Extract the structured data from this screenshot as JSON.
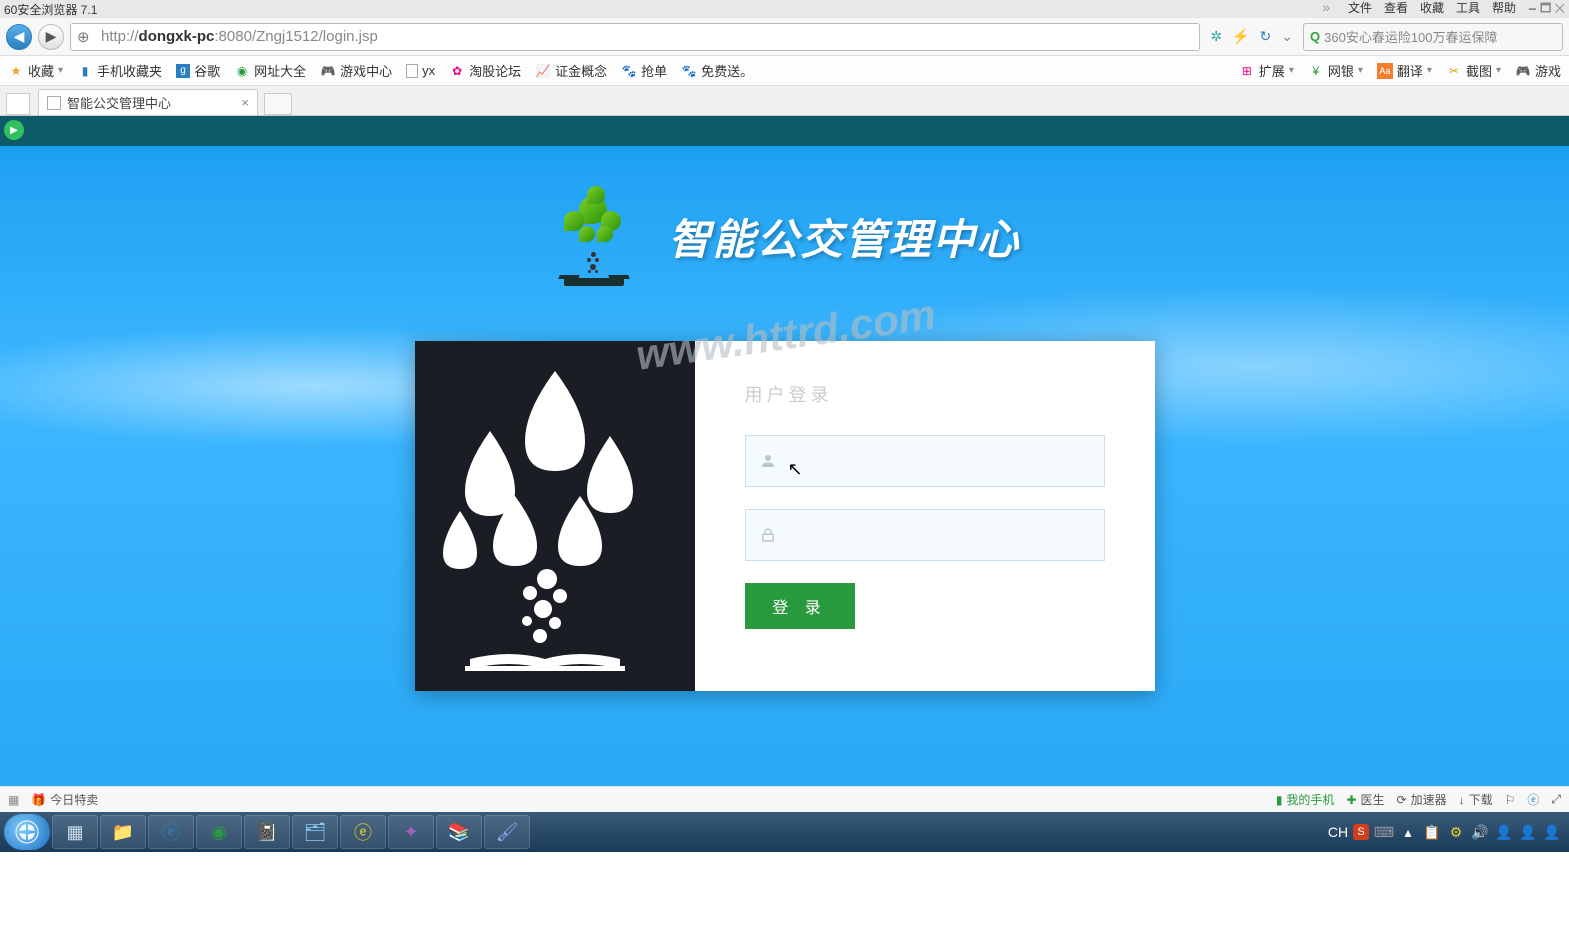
{
  "browser": {
    "title": "60安全浏览器 7.1",
    "menu": [
      "文件",
      "查看",
      "收藏",
      "工具",
      "帮助"
    ],
    "url_host": "dongxk-pc",
    "url_rest": ":8080/Zngj1512/login.jsp",
    "url_prefix": "http://",
    "search_placeholder": "360安心春运险100万春运保障"
  },
  "bookmarks": {
    "fav": "收藏",
    "items": [
      "手机收藏夹",
      "谷歌",
      "网址大全",
      "游戏中心",
      "yx",
      "淘股论坛",
      "证金概念",
      "抢单",
      "免费送。"
    ],
    "right": [
      "扩展",
      "网银",
      "翻译",
      "截图",
      "游戏"
    ]
  },
  "tab": {
    "title": "智能公交管理中心"
  },
  "page": {
    "heading": "智能公交管理中心",
    "form_label": "用户登录",
    "login_btn": "登 录",
    "watermark": "www.httrd.com"
  },
  "bottom": {
    "today": "今日特卖",
    "items": [
      "我的手机",
      "医生",
      "加速器",
      "下载"
    ],
    "ime": "CH"
  }
}
